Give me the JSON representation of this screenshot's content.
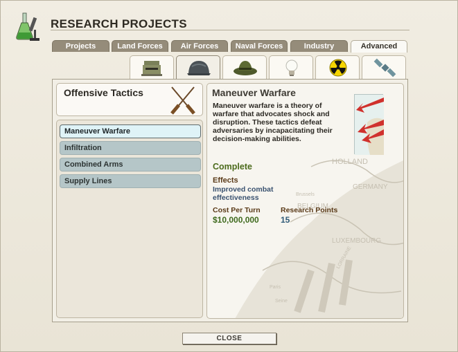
{
  "window": {
    "title": "RESEARCH PROJECTS",
    "icon": "flask-microscope-icon"
  },
  "tabs": [
    {
      "label": "Projects",
      "active": false
    },
    {
      "label": "Land Forces",
      "active": false
    },
    {
      "label": "Air Forces",
      "active": false
    },
    {
      "label": "Naval Forces",
      "active": false
    },
    {
      "label": "Industry",
      "active": false
    },
    {
      "label": "Advanced",
      "active": true
    }
  ],
  "subtabs": [
    {
      "icon": "bunker-icon",
      "active": false
    },
    {
      "icon": "combat-helmet-icon",
      "active": true
    },
    {
      "icon": "campaign-hat-icon",
      "active": false
    },
    {
      "icon": "light-bulb-icon",
      "active": false
    },
    {
      "icon": "radiation-icon",
      "active": false
    },
    {
      "icon": "satellite-icon",
      "active": false
    }
  ],
  "category": {
    "title": "Offensive Tactics",
    "icon": "crossed-rifles-icon"
  },
  "projects": [
    {
      "label": "Maneuver Warfare",
      "selected": true
    },
    {
      "label": "Infiltration",
      "selected": false
    },
    {
      "label": "Combined Arms",
      "selected": false
    },
    {
      "label": "Supply Lines",
      "selected": false
    }
  ],
  "detail": {
    "title": "Maneuver Warfare",
    "description": "Maneuver warfare is a theory of warfare that advocates shock and disruption.  These tactics defeat adversaries by incapacitating their decision-making abilities.",
    "status": "Complete",
    "effects_heading": "Effects",
    "effects": "Improved combat effectiveness",
    "cost_heading": "Cost Per Turn",
    "cost": "$10,000,000",
    "points_heading": "Research Points",
    "points": "15",
    "map_labels": [
      "HOLLAND",
      "GERMANY",
      "BELGIUM",
      "LUXEMBOURG",
      "Brussels",
      "Paris",
      "Seine",
      "LORRAINE"
    ]
  },
  "buttons": {
    "close": "CLOSE"
  },
  "colors": {
    "tab_inactive": "#958c7a",
    "tab_active": "#faf9f5",
    "list_item": "#b5c6c8",
    "list_item_selected": "#dff3f7",
    "status_complete": "#4c6b1c"
  }
}
